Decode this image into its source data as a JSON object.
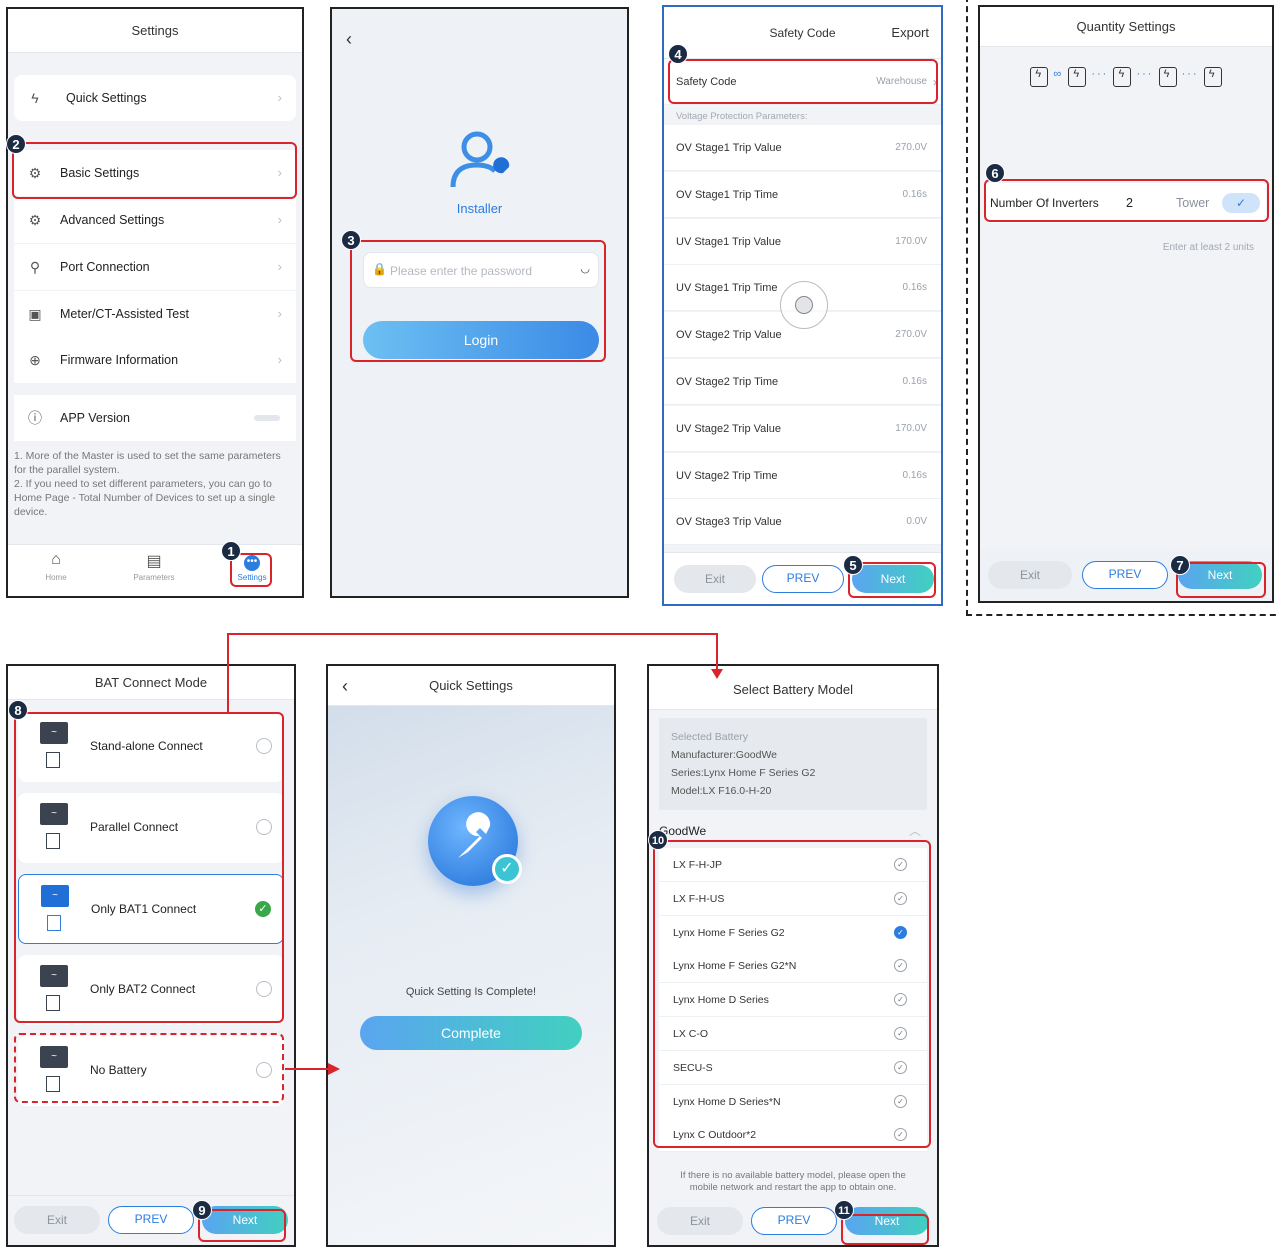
{
  "markers": [
    "1",
    "2",
    "3",
    "4",
    "5",
    "6",
    "7",
    "8",
    "9",
    "10",
    "11"
  ],
  "settings_panel": {
    "title": "Settings",
    "items": [
      {
        "label": "Quick Settings",
        "icon": "lightning-icon"
      },
      {
        "label": "Basic Settings",
        "icon": "gear-icon"
      },
      {
        "label": "Advanced Settings",
        "icon": "gear-search-icon"
      },
      {
        "label": "Port Connection",
        "icon": "port-icon"
      },
      {
        "label": "Meter/CT-Assisted Test",
        "icon": "meter-icon"
      },
      {
        "label": "Firmware Information",
        "icon": "upload-icon"
      },
      {
        "label": "APP Version",
        "icon": "info-icon"
      }
    ],
    "note": "1. More of the Master is used to set the same parameters for the parallel system.\n2. If you need to set different parameters, you can go to Home Page - Total Number of Devices to set up a single device.",
    "tabs": [
      "Home",
      "Parameters",
      "Settings"
    ]
  },
  "login_panel": {
    "role": "Installer",
    "password_placeholder": "Please enter the password",
    "login_label": "Login"
  },
  "safety_panel": {
    "title": "Safety Code",
    "export_label": "Export",
    "safety_code_label": "Safety Code",
    "safety_code_value": "Warehouse",
    "section_label": "Voltage Protection Parameters:",
    "rows": [
      {
        "k": "OV Stage1 Trip Value",
        "v": "270.0V"
      },
      {
        "k": "OV Stage1 Trip Time",
        "v": "0.16s"
      },
      {
        "k": "UV Stage1 Trip Value",
        "v": "170.0V"
      },
      {
        "k": "UV Stage1 Trip Time",
        "v": "0.16s"
      },
      {
        "k": "OV Stage2 Trip Value",
        "v": "270.0V"
      },
      {
        "k": "OV Stage2 Trip Time",
        "v": "0.16s"
      },
      {
        "k": "UV Stage2 Trip Value",
        "v": "170.0V"
      },
      {
        "k": "UV Stage2 Trip Time",
        "v": "0.16s"
      },
      {
        "k": "OV Stage3 Trip Value",
        "v": "0.0V"
      }
    ]
  },
  "buttons": {
    "exit": "Exit",
    "prev": "PREV",
    "next": "Next"
  },
  "quantity_panel": {
    "title": "Quantity Settings",
    "inverters_label": "Number Of Inverters",
    "inverters_value": "2",
    "tower_label": "Tower",
    "hint": "Enter at least 2 units"
  },
  "bat_panel": {
    "title": "BAT Connect Mode",
    "modes": [
      {
        "label": "Stand-alone Connect",
        "selected": false
      },
      {
        "label": "Parallel Connect",
        "selected": false
      },
      {
        "label": "Only BAT1 Connect",
        "selected": true
      },
      {
        "label": "Only BAT2 Connect",
        "selected": false
      },
      {
        "label": "No Battery",
        "selected": false
      }
    ]
  },
  "quick_panel": {
    "title": "Quick Settings",
    "message": "Quick Setting Is Complete!",
    "complete_label": "Complete"
  },
  "battery_model_panel": {
    "title": "Select Battery Model",
    "selected_title": "Selected Battery",
    "manufacturer": "Manufacturer:GoodWe",
    "series": "Series:Lynx Home F Series G2",
    "model": "Model:LX F16.0-H-20",
    "group": "GoodWe",
    "models": [
      {
        "label": "LX F-H-JP",
        "selected": false
      },
      {
        "label": "LX F-H-US",
        "selected": false
      },
      {
        "label": "Lynx Home F Series G2",
        "selected": true
      },
      {
        "label": "Lynx Home F Series G2*N",
        "selected": false
      },
      {
        "label": "Lynx Home D Series",
        "selected": false
      },
      {
        "label": "LX C-O",
        "selected": false
      },
      {
        "label": "SECU-S",
        "selected": false
      },
      {
        "label": "Lynx Home D Series*N",
        "selected": false
      },
      {
        "label": "Lynx C Outdoor*2",
        "selected": false
      }
    ],
    "footer_note": "If there is no available battery model, please open the mobile network and restart the app to obtain one."
  },
  "colors": {
    "accent": "#2b7de0",
    "marker": "#d9242c",
    "success": "#3aa84a"
  }
}
